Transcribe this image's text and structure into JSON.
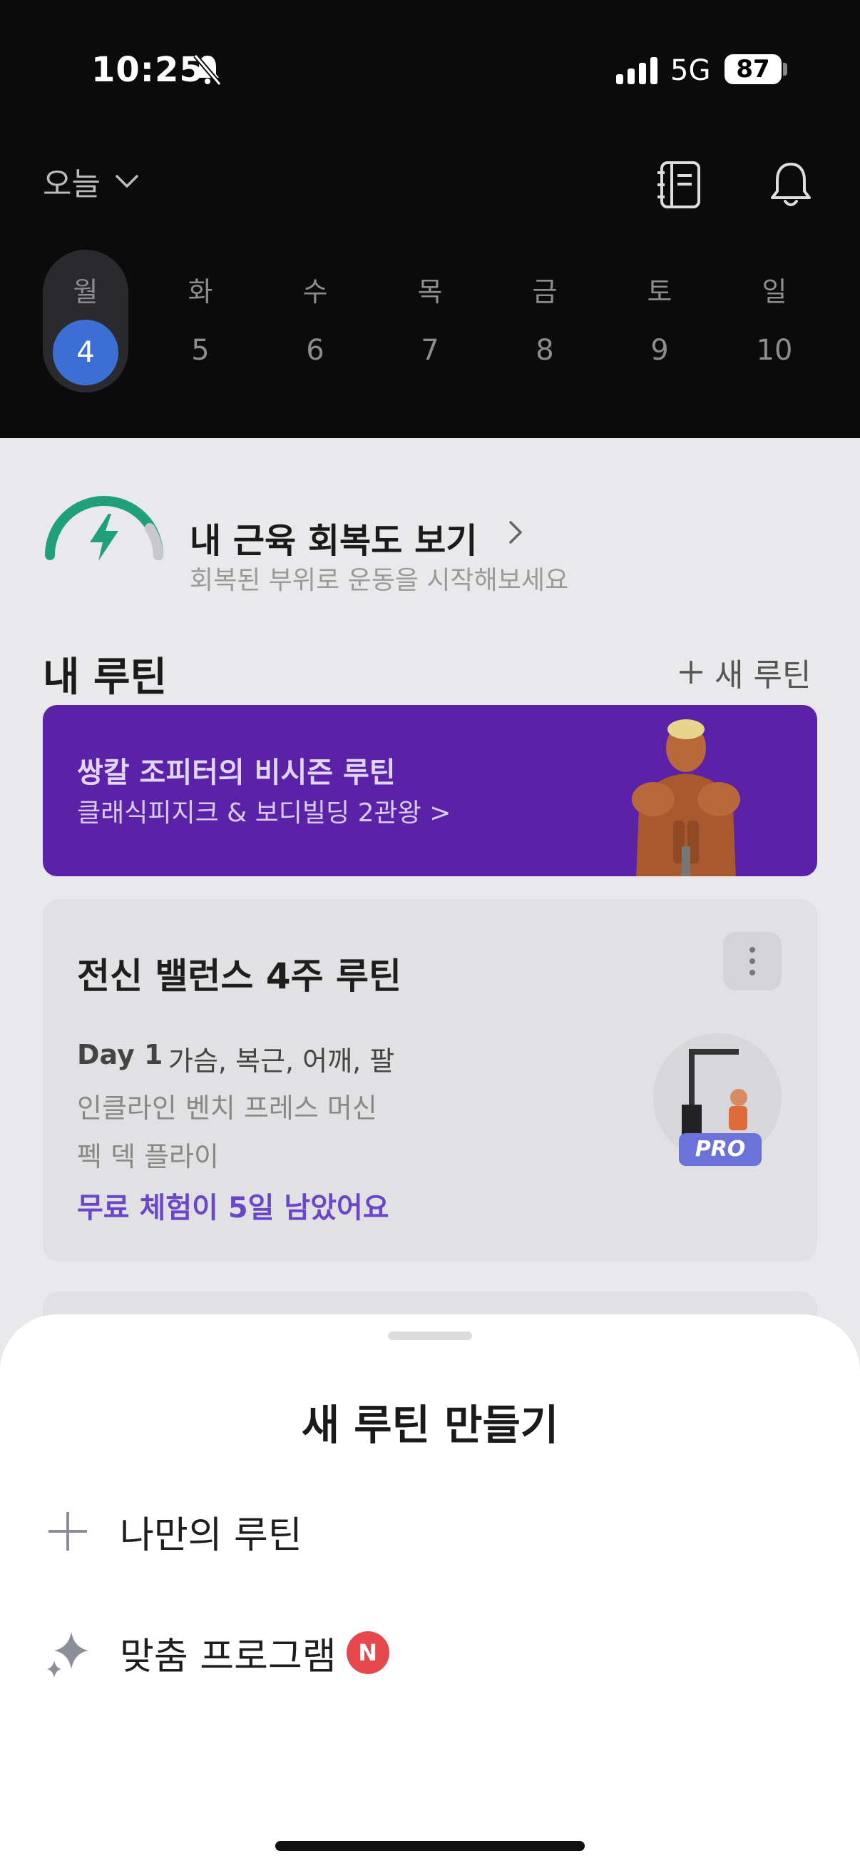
{
  "status_bar": {
    "time": "10:25",
    "network": "5G",
    "battery": "87"
  },
  "header": {
    "day_selector": "오늘"
  },
  "week": [
    {
      "day": "월",
      "date": "4",
      "selected": true
    },
    {
      "day": "화",
      "date": "5"
    },
    {
      "day": "수",
      "date": "6"
    },
    {
      "day": "목",
      "date": "7"
    },
    {
      "day": "금",
      "date": "8"
    },
    {
      "day": "토",
      "date": "9"
    },
    {
      "day": "일",
      "date": "10"
    }
  ],
  "recovery": {
    "title": "내 근육 회복도 보기",
    "subtitle": "회복된 부위로 운동을 시작해보세요"
  },
  "routines": {
    "section_title": "내 루틴",
    "new_label": "새 루틴",
    "promo": {
      "title": "쌍칼 조피터의 비시즌 루틴",
      "subtitle": "클래식피지크 & 보디빌딩 2관왕 >"
    },
    "card": {
      "title": "전신 밸런스 4주 루틴",
      "day_label": "Day 1",
      "day_parts": "가슴, 복근, 어깨, 팔",
      "exercises": [
        "인클라인 벤치 프레스 머신",
        "펙 덱 플라이"
      ],
      "trial": "무료 체험이 5일 남았어요",
      "badge": "PRO"
    }
  },
  "sheet": {
    "title": "새 루틴 만들기",
    "options": [
      {
        "label": "나만의 루틴",
        "icon": "plus-icon"
      },
      {
        "label": "맞춤 프로그램",
        "icon": "sparkle-icon",
        "badge": "N"
      }
    ]
  },
  "colors": {
    "accent_blue": "#3b6fd4",
    "promo_purple": "#5a22a6",
    "trial_purple": "#6a46c8",
    "gauge_green": "#1fa079",
    "badge_red": "#e5484d"
  }
}
